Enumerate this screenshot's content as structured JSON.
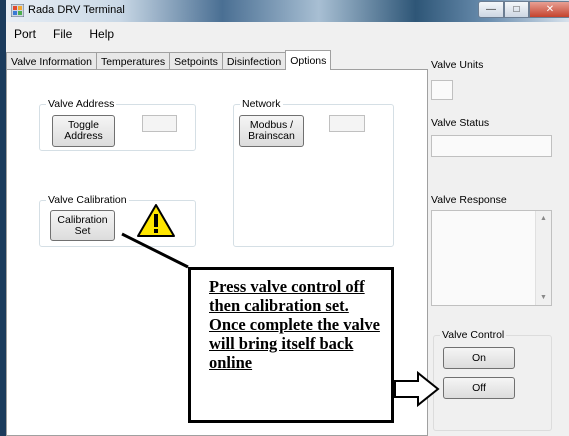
{
  "window": {
    "title": "Rada DRV Terminal"
  },
  "menu": {
    "items": [
      "Port",
      "File",
      "Help"
    ]
  },
  "tabs": [
    "Valve Information",
    "Temperatures",
    "Setpoints",
    "Disinfection",
    "Options"
  ],
  "options": {
    "valve_address": {
      "label": "Valve Address",
      "button": "Toggle\nAddress"
    },
    "network": {
      "label": "Network",
      "button": "Modbus /\nBrainscan"
    },
    "valve_calibration": {
      "label": "Valve Calibration",
      "button": "Calibration\nSet"
    }
  },
  "side": {
    "valve_units": "Valve Units",
    "valve_status": "Valve Status",
    "valve_response": "Valve Response",
    "valve_control": {
      "label": "Valve Control",
      "on": "On",
      "off": "Off"
    }
  },
  "callout": {
    "text": "Press valve control off then calibration set. Once complete the valve will bring itself back online"
  },
  "colors": {
    "accent_border": "#000000",
    "warning_fill": "#ffe600"
  }
}
